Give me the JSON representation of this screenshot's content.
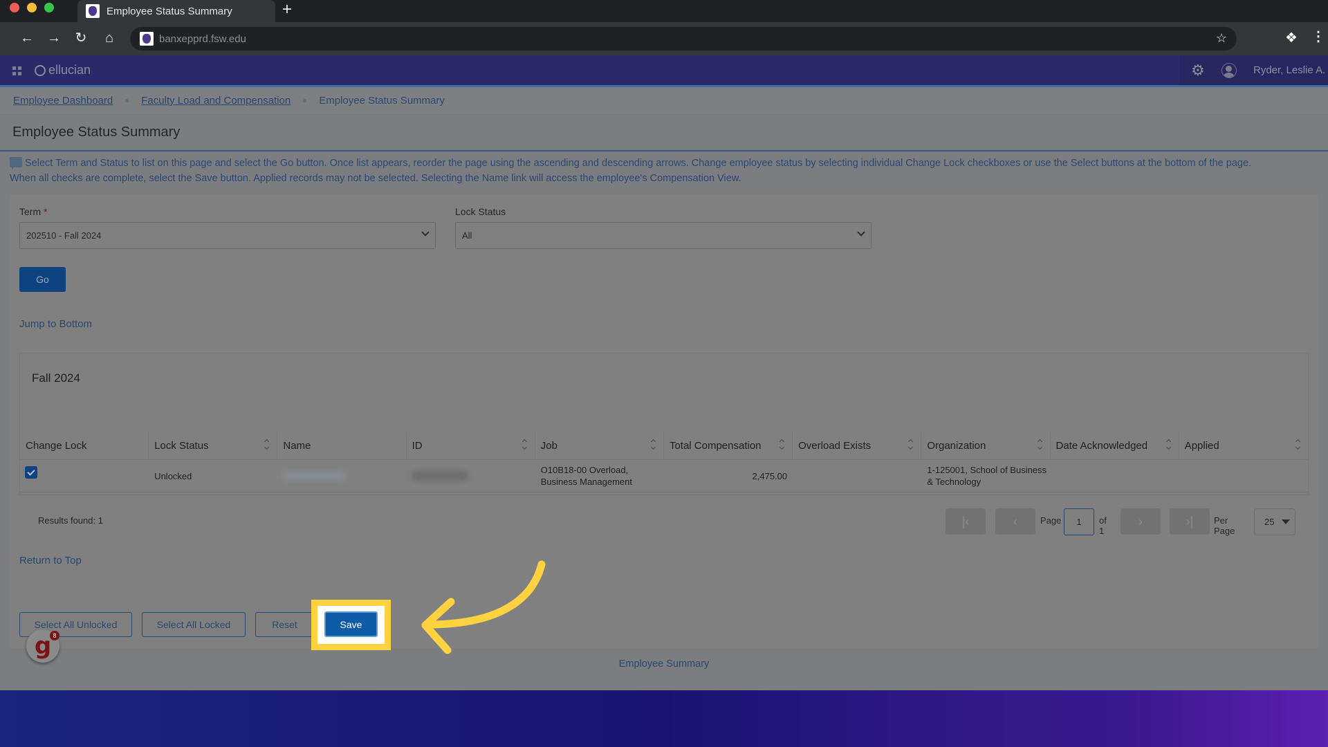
{
  "browser": {
    "tab_title": "Employee Status Summary",
    "new_tab_label": "+",
    "url": "banxepprd.fsw.edu"
  },
  "appbar": {
    "brand": "ellucian",
    "user_name": "Ryder, Leslie A."
  },
  "breadcrumb": {
    "items": [
      "Employee Dashboard",
      "Faculty Load and Compensation"
    ],
    "current": "Employee Status Summary"
  },
  "page": {
    "title": "Employee Status Summary",
    "info_line1": "Select Term and Status to list on this page and select the Go button. Once list appears, reorder the page using the ascending and descending arrows. Change employee status by selecting individual Change Lock checkboxes or use the Select buttons at the bottom of the page.",
    "info_line2": "When all checks are complete, select the Save button. Applied records may not be selected. Selecting the Name link will access the employee's Compensation View."
  },
  "filters": {
    "term_label": "Term",
    "term_required": "*",
    "term_value": "202510 - Fall 2024",
    "lock_status_label": "Lock Status",
    "lock_status_value": "All",
    "go_label": "Go"
  },
  "links": {
    "jump_to_bottom": "Jump to Bottom",
    "return_to_top": "Return to Top",
    "footer": "Employee Summary"
  },
  "results": {
    "term_heading": "Fall 2024",
    "columns": [
      "Change Lock",
      "Lock Status",
      "Name",
      "ID",
      "Job",
      "Total Compensation",
      "Overload Exists",
      "Organization",
      "Date Acknowledged",
      "Applied"
    ],
    "rows": [
      {
        "change_lock": true,
        "lock_status": "Unlocked",
        "name": "",
        "id": "",
        "job": "O10B18-00 Overload, Business Management",
        "total_compensation": "2,475.00",
        "overload_exists": "",
        "organization": "1-125001, School of Business & Technology",
        "date_acknowledged": "",
        "applied": ""
      }
    ],
    "results_found": "Results found: 1"
  },
  "pagination": {
    "page_label": "Page",
    "current_page": "1",
    "of_label": "of 1",
    "per_page_label": "Per Page",
    "per_page_value": "25"
  },
  "actions": {
    "select_all_unlocked": "Select All Unlocked",
    "select_all_locked": "Select All Locked",
    "reset": "Reset",
    "save": "Save"
  },
  "widget": {
    "letter": "g",
    "count": "8"
  },
  "colors": {
    "highlight": "#ffd23f",
    "primary_button": "#0d5aa6",
    "appbar": "#2b2968"
  }
}
